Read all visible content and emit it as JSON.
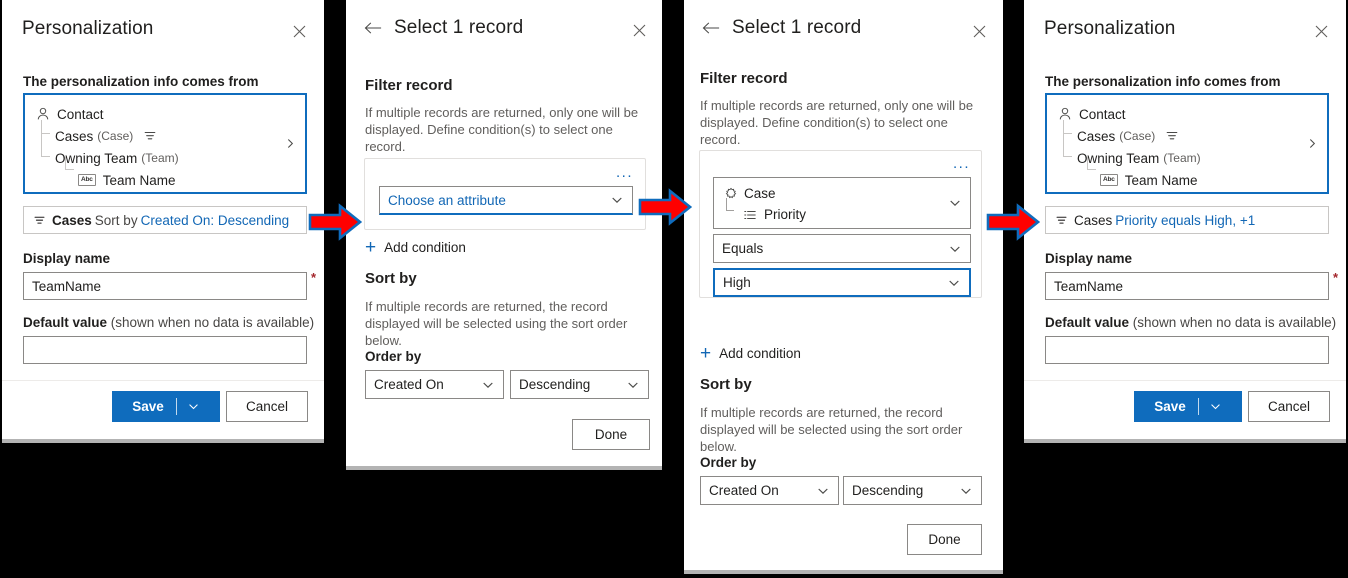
{
  "panels": [
    {
      "id": "personalization-initial",
      "title": "Personalization",
      "source_label": "The personalization info comes from",
      "tree": {
        "root": {
          "label": "Contact",
          "icon": "contact-person-icon"
        },
        "children": [
          {
            "label": "Cases",
            "entity": "(Case)",
            "icon": "filter-icon",
            "trailing_icon": "filter-icon"
          },
          {
            "label": "Owning Team",
            "entity": "(Team)",
            "icon": "none"
          }
        ],
        "leaf": {
          "label": "Team Name",
          "badge": "Abc",
          "icon": "text-field-icon"
        },
        "expand_icon": "chevron-right-icon"
      },
      "filter_summary": {
        "icon": "filter-icon",
        "entity": "Cases",
        "middle": "Sort by",
        "link": "Created On: Descending"
      },
      "display_name": {
        "label": "Display name",
        "value": "TeamName",
        "required": true
      },
      "default_value": {
        "label_strong": "Default value",
        "label_normal": "(shown when no data is available)",
        "value": ""
      },
      "buttons": {
        "save": "Save",
        "cancel": "Cancel",
        "save_split_icon": "chevron-down-icon"
      },
      "close_icon": "close-icon"
    },
    {
      "id": "select-record-empty",
      "title": "Select 1 record",
      "back_icon": "arrow-left-icon",
      "close_icon": "close-icon",
      "filter_record": {
        "heading": "Filter record",
        "help": "If multiple records are returned, only one will be displayed. Define condition(s) to select one record."
      },
      "condition": {
        "overflow_icon": "ellipsis-icon",
        "overflow_label": "...",
        "attribute_placeholder": "Choose an attribute",
        "chevron_icon": "chevron-down-icon"
      },
      "add_condition": {
        "label": "Add condition",
        "icon": "plus-icon"
      },
      "sort_by": {
        "heading": "Sort by",
        "help": "If multiple records are returned, the record displayed will be selected using the sort order below.",
        "order_by_label": "Order by",
        "field": "Created On",
        "direction": "Descending"
      },
      "done_label": "Done"
    },
    {
      "id": "select-record-filled",
      "title": "Select 1 record",
      "back_icon": "arrow-left-icon",
      "close_icon": "close-icon",
      "filter_record": {
        "heading": "Filter record",
        "help": "If multiple records are returned, only one will be displayed. Define condition(s) to select one record."
      },
      "condition": {
        "overflow_icon": "ellipsis-icon",
        "overflow_label": "...",
        "entity": "Case",
        "entity_icon": "case-icon",
        "attribute": "Priority",
        "attribute_icon": "optionset-list-icon",
        "operator": "Equals",
        "value": "High",
        "chevron_icon": "chevron-down-icon"
      },
      "add_condition": {
        "label": "Add condition",
        "icon": "plus-icon"
      },
      "sort_by": {
        "heading": "Sort by",
        "help": "If multiple records are returned, the record displayed will be selected using the sort order below.",
        "order_by_label": "Order by",
        "field": "Created On",
        "direction": "Descending"
      },
      "done_label": "Done"
    },
    {
      "id": "personalization-final",
      "title": "Personalization",
      "source_label": "The personalization info comes from",
      "tree": {
        "root": {
          "label": "Contact",
          "icon": "contact-person-icon"
        },
        "children": [
          {
            "label": "Cases",
            "entity": "(Case)",
            "icon": "filter-icon",
            "trailing_icon": "filter-icon"
          },
          {
            "label": "Owning Team",
            "entity": "(Team)",
            "icon": "none"
          }
        ],
        "leaf": {
          "label": "Team Name",
          "badge": "Abc",
          "icon": "text-field-icon"
        },
        "expand_icon": "chevron-right-icon"
      },
      "filter_summary": {
        "icon": "filter-icon",
        "entity": "Cases",
        "middle": "",
        "link": "Priority equals High, +1"
      },
      "display_name": {
        "label": "Display name",
        "value": "TeamName",
        "required": true
      },
      "default_value": {
        "label_strong": "Default value",
        "label_normal": "(shown when no data is available)",
        "value": ""
      },
      "buttons": {
        "save": "Save",
        "cancel": "Cancel",
        "save_split_icon": "chevron-down-icon"
      },
      "close_icon": "close-icon"
    }
  ],
  "arrows": [
    {
      "name": "arrow-1",
      "icon": "right-arrow-annotation"
    },
    {
      "name": "arrow-2",
      "icon": "right-arrow-annotation"
    },
    {
      "name": "arrow-3",
      "icon": "right-arrow-annotation"
    }
  ],
  "colors": {
    "accent": "#0f6cbd",
    "link": "#1267b5",
    "required": "#a4262c",
    "arrow_fill": "#ff0000",
    "arrow_stroke": "#0f6cbd",
    "background": "#000000"
  }
}
